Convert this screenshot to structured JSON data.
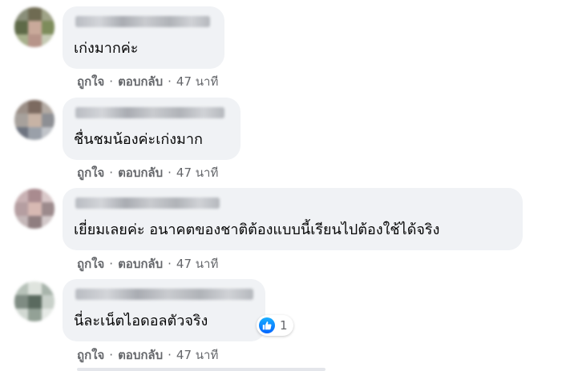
{
  "actions": {
    "like_label": "ถูกใจ",
    "reply_label": "ตอบกลับ",
    "separator": "·"
  },
  "comments": [
    {
      "text": "เก่งมากค่ะ",
      "time": "47 นาที"
    },
    {
      "text": "ชื่นชมน้องค่ะเก่งมาก",
      "time": "47 นาที"
    },
    {
      "text": "เยี่ยมเลยค่ะ อนาคตของชาติต้องแบบนี้เรียนไปต้องใช้ได้จริง",
      "time": "47 นาที"
    },
    {
      "text": "นี่ละเน็ตไอดอลตัวจริง",
      "time": "47 นาที",
      "reaction": {
        "icon": "thumbs-up-icon",
        "count": "1"
      }
    }
  ],
  "colors": {
    "bubble": "#f0f2f5",
    "meta_text": "#65676b",
    "body_text": "#050505",
    "like_blue": "#0566ff"
  }
}
